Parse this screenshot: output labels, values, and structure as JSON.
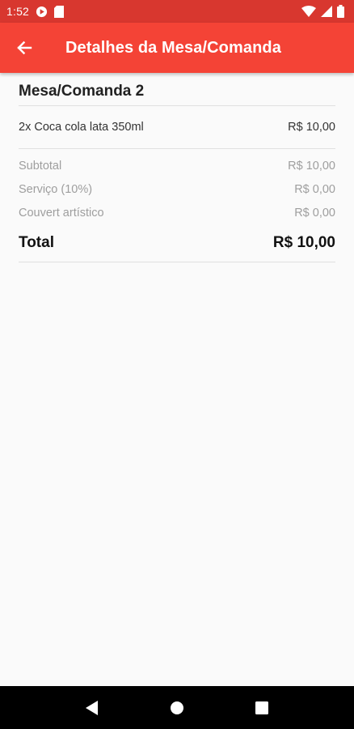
{
  "status_bar": {
    "time": "1:52",
    "icons": [
      "play-protect-icon",
      "sd-card-icon",
      "wifi-icon",
      "signal-icon",
      "battery-icon"
    ]
  },
  "app_bar": {
    "title": "Detalhes da Mesa/Comanda",
    "back_icon": "arrow-left-icon",
    "color": "#f44336",
    "status_color": "#d8372f"
  },
  "order": {
    "table_name": "Mesa/Comanda 2",
    "items": [
      {
        "description": "2x Coca cola lata 350ml",
        "price": "R$ 10,00"
      }
    ],
    "summary": [
      {
        "label": "Subtotal",
        "value": "R$ 10,00"
      },
      {
        "label": "Serviço (10%)",
        "value": "R$ 0,00"
      },
      {
        "label": "Couvert artístico",
        "value": "R$ 0,00"
      }
    ],
    "total_label": "Total",
    "total_value": "R$ 10,00"
  },
  "nav_bar": {
    "buttons": [
      "back-triangle-icon",
      "home-circle-icon",
      "recents-square-icon"
    ]
  }
}
